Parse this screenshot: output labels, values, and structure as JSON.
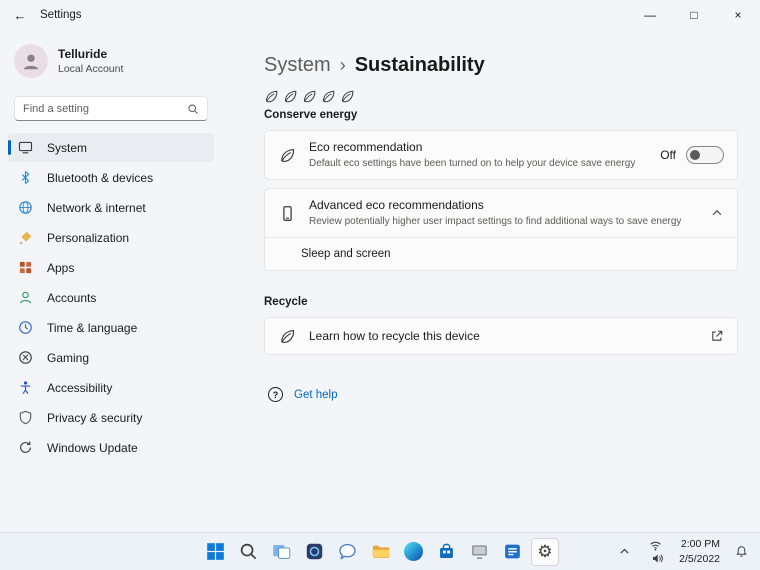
{
  "titlebar": {
    "title": "Settings"
  },
  "glyphs": {
    "back": "←",
    "minimize": "—",
    "maximize": "□",
    "close": "×",
    "breadcrumb_separator": "›",
    "gear": "⚙",
    "help": "?"
  },
  "sidebar": {
    "user": {
      "name": "Telluride",
      "type": "Local Account"
    },
    "search": {
      "placeholder": "Find a setting"
    },
    "items": [
      {
        "label": "System"
      },
      {
        "label": "Bluetooth & devices"
      },
      {
        "label": "Network & internet"
      },
      {
        "label": "Personalization"
      },
      {
        "label": "Apps"
      },
      {
        "label": "Accounts"
      },
      {
        "label": "Time & language"
      },
      {
        "label": "Gaming"
      },
      {
        "label": "Accessibility"
      },
      {
        "label": "Privacy & security"
      },
      {
        "label": "Windows Update"
      }
    ]
  },
  "main": {
    "breadcrumb": {
      "root": "System",
      "current": "Sustainability"
    },
    "conserve": {
      "title": "Conserve energy",
      "eco_card": {
        "title": "Eco recommendation",
        "description": "Default eco settings have been turned on to help your device save energy",
        "toggle_label": "Off"
      },
      "advanced_card": {
        "title": "Advanced eco recommendations",
        "description": "Review potentially higher user impact settings to find additional ways to save energy",
        "sub_item": "Sleep and screen"
      }
    },
    "recycle": {
      "title": "Recycle",
      "card_title": "Learn how to recycle this device"
    },
    "get_help": "Get help"
  },
  "taskbar": {
    "clock": {
      "time": "2:00 PM",
      "date": "2/5/2022"
    }
  },
  "colors": {
    "accent": "#0067c0"
  }
}
